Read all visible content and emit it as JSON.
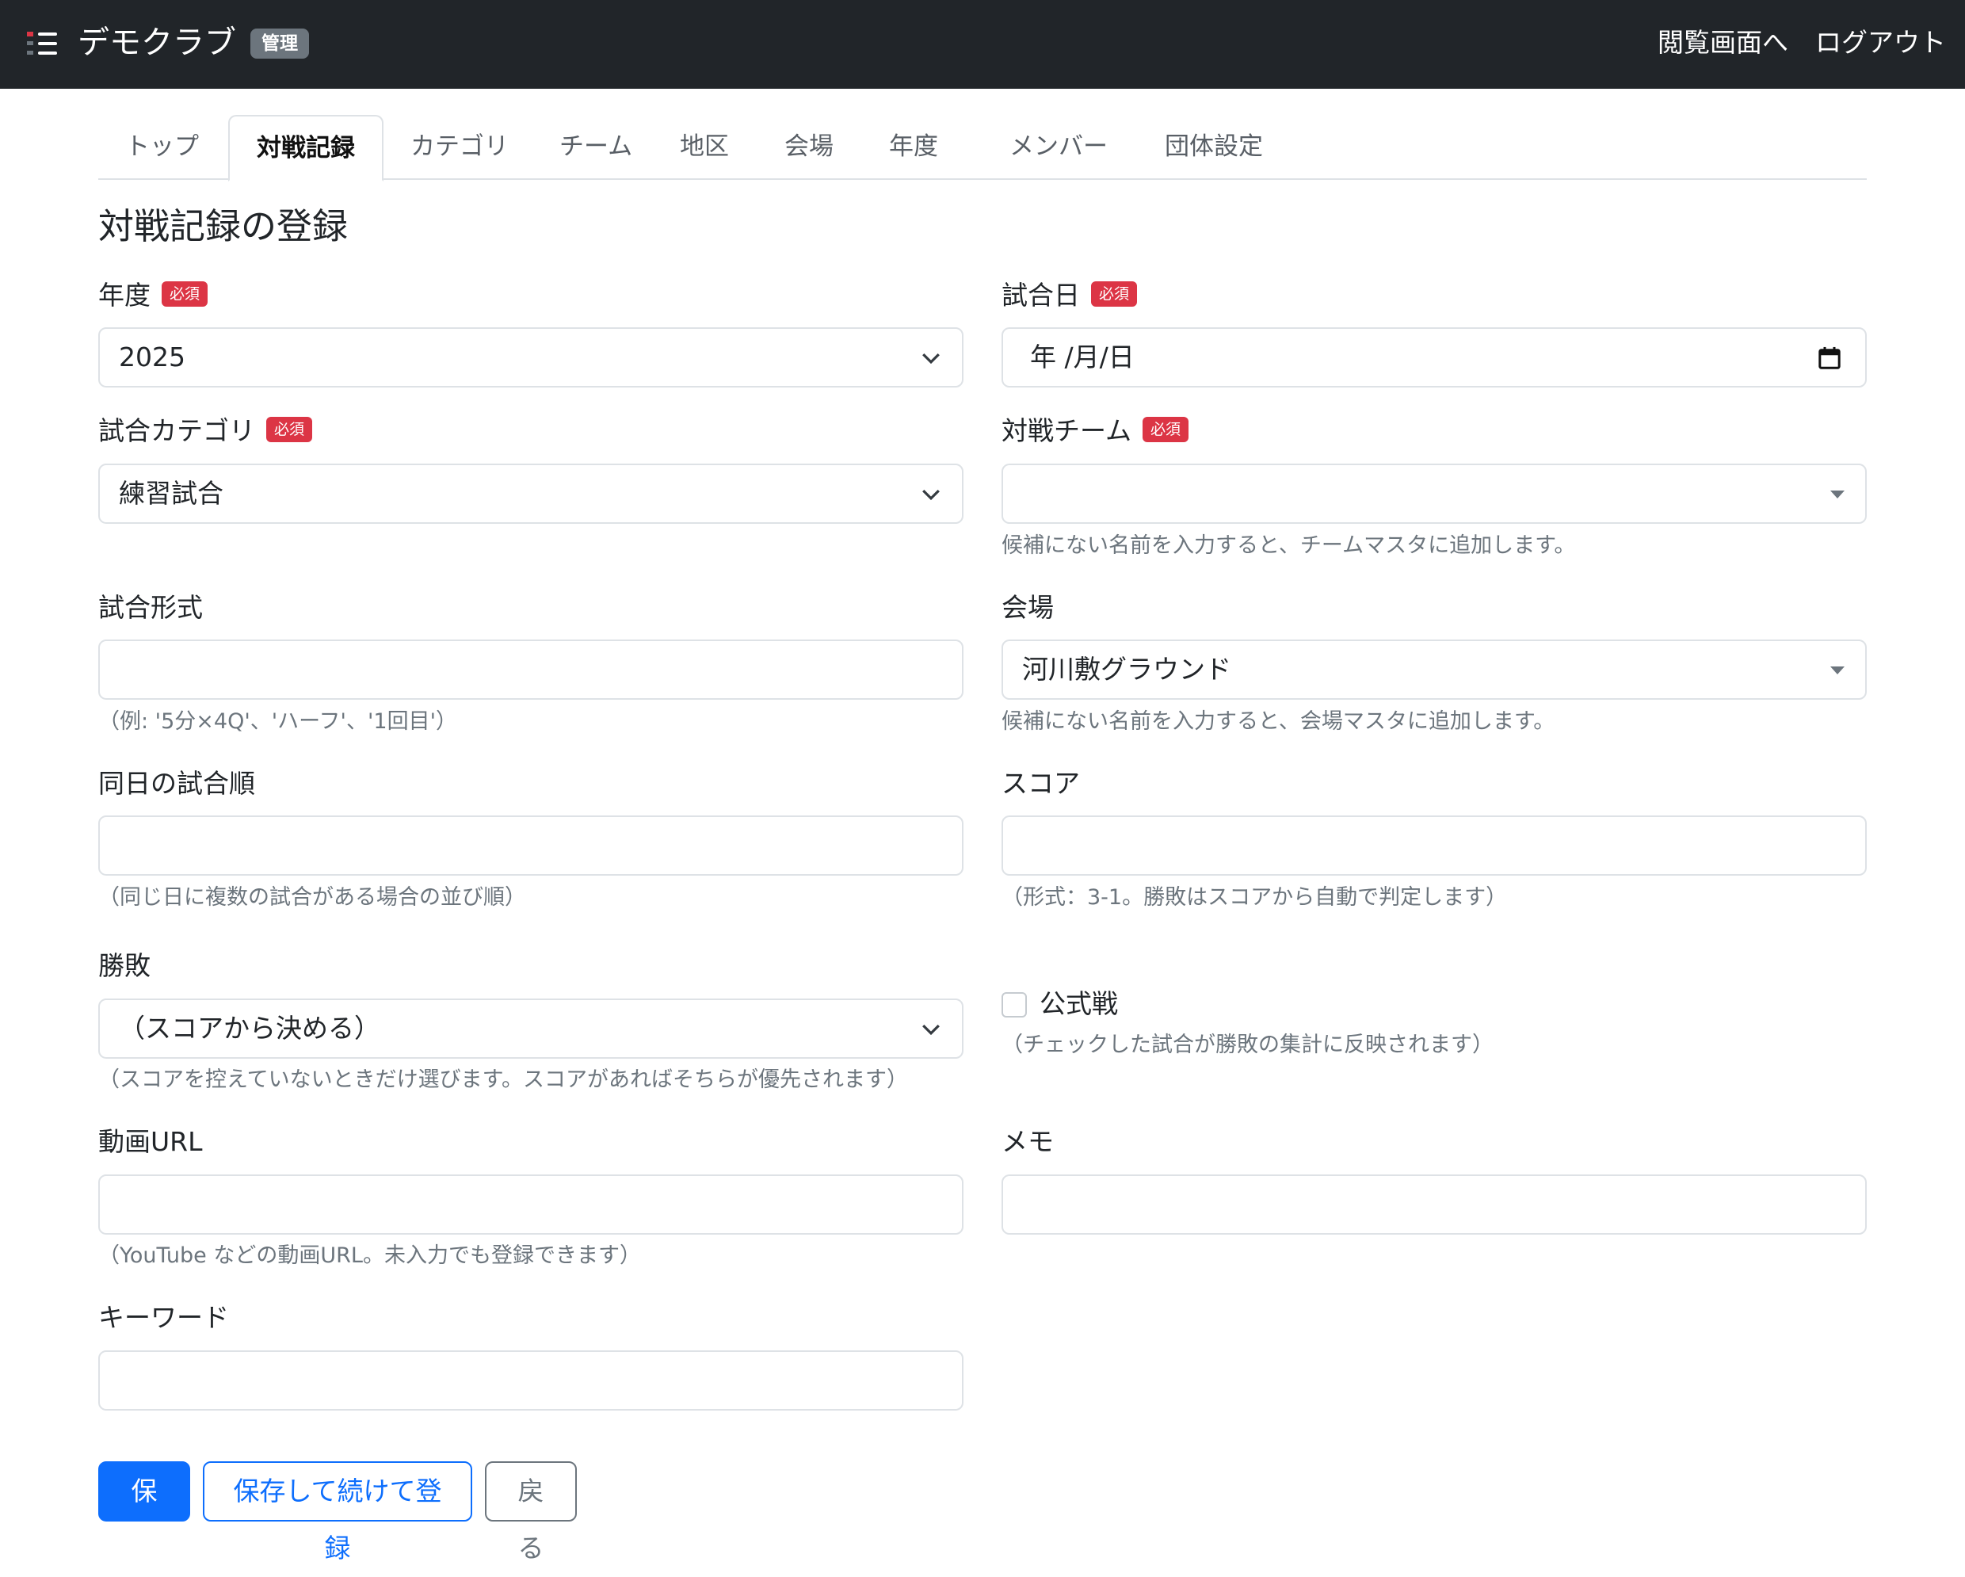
{
  "navbar": {
    "brand": "デモクラブ",
    "badge": "管理",
    "links": [
      "閲覧画面へ",
      "ログアウト"
    ]
  },
  "tabs": [
    {
      "label": "トップ",
      "active": false
    },
    {
      "label": "対戦記録",
      "active": true
    },
    {
      "label": "カテゴリ",
      "active": false
    },
    {
      "label": "チーム",
      "active": false
    },
    {
      "label": "地区",
      "active": false
    },
    {
      "label": "会場",
      "active": false
    },
    {
      "label": "年度",
      "active": false
    },
    {
      "label": "メンバー",
      "active": false
    },
    {
      "label": "団体設定",
      "active": false
    }
  ],
  "page_title": "対戦記録の登録",
  "required_badge": "必須",
  "form": {
    "year": {
      "label": "年度",
      "value": "2025"
    },
    "match_date": {
      "label": "試合日",
      "value": "年 /月/日"
    },
    "category": {
      "label": "試合カテゴリ",
      "value": "練習試合"
    },
    "opponent": {
      "label": "対戦チーム",
      "value": "",
      "help": "候補にない名前を入力すると、チームマスタに追加します。"
    },
    "format": {
      "label": "試合形式",
      "value": "",
      "help": "（例: '5分×4Q'、'ハーフ'、'1回目'）"
    },
    "venue": {
      "label": "会場",
      "value": "河川敷グラウンド",
      "help": "候補にない名前を入力すると、会場マスタに追加します。"
    },
    "order": {
      "label": "同日の試合順",
      "value": "",
      "help": "（同じ日に複数の試合がある場合の並び順）"
    },
    "score": {
      "label": "スコア",
      "value": "",
      "help": "（形式：3-1。勝敗はスコアから自動で判定します）"
    },
    "result": {
      "label": "勝敗",
      "value": "（スコアから決める）",
      "help": "（スコアを控えていないときだけ選びます。スコアがあればそちらが優先されます）"
    },
    "official": {
      "label": "公式戦",
      "checked": false,
      "help": "（チェックした試合が勝敗の集計に反映されます）"
    },
    "video_url": {
      "label": "動画URL",
      "value": "",
      "help": "（YouTube などの動画URL。未入力でも登録できます）"
    },
    "memo": {
      "label": "メモ",
      "value": ""
    },
    "keyword": {
      "label": "キーワード",
      "value": ""
    }
  },
  "buttons": {
    "save": "保存",
    "save_continue": "保存して続けて登録",
    "back": "戻る"
  },
  "colors": {
    "navbar": "#212529",
    "primary": "#0d6efd",
    "danger": "#dc3545",
    "secondary": "#6c757d"
  }
}
